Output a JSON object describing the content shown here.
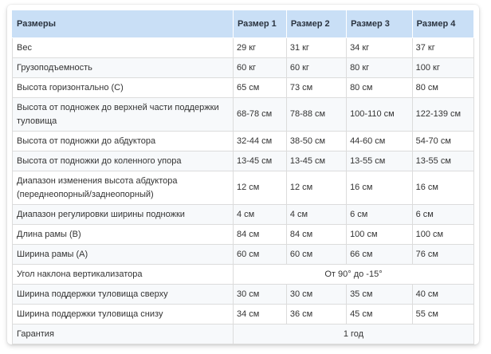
{
  "table": {
    "headers": [
      "Размеры",
      "Размер 1",
      "Размер 2",
      "Размер 3",
      "Размер 4"
    ],
    "rows": [
      {
        "label": "Вес",
        "values": [
          "29 кг",
          "31 кг",
          "34 кг",
          " 37 кг"
        ]
      },
      {
        "label": "Грузоподъемность",
        "values": [
          "60 кг",
          "60 кг",
          "80 кг",
          "100 кг"
        ]
      },
      {
        "label": "Высота горизонтально (С)",
        "values": [
          "65 см",
          "73 см",
          "80 см",
          "80 см"
        ]
      },
      {
        "label": "Высота от подножек до верхней части поддержки туловища",
        "values": [
          "68-78 см",
          "78-88 см",
          "100-110 см",
          "122-139 см"
        ]
      },
      {
        "label": "Высота от подножки до абдуктора",
        "values": [
          "32-44 см",
          "38-50 см",
          "44-60 см",
          "54-70 см"
        ]
      },
      {
        "label": "Высота от подножки до коленного упора",
        "values": [
          "13-45 см",
          "13-45 см",
          "13-55 см",
          "13-55 см"
        ]
      },
      {
        "label": "Диапазон изменения высота абдуктора (переднеопорный/заднеопорный)",
        "values": [
          "12 см",
          "12 см",
          "16 см",
          "16 см"
        ]
      },
      {
        "label": "Диапазон регулировки ширины подножки",
        "values": [
          "4 см",
          "4 см",
          "6 см",
          " 6 см"
        ]
      },
      {
        "label": "Длина рамы (В)",
        "values": [
          "84 см",
          "84 см",
          "100 см",
          "100 см"
        ]
      },
      {
        "label": "Ширина рамы (А)",
        "values": [
          "60 см",
          "60 см",
          "66 см",
          "76 см"
        ]
      },
      {
        "label": "Угол наклона вертикализатора",
        "merged": "От 90° до -15°"
      },
      {
        "label": "Ширина поддержки туловища сверху",
        "values": [
          "30 см",
          "30 см",
          "35 см",
          "40 см"
        ]
      },
      {
        "label": "Ширина поддержки туловища снизу",
        "values": [
          "34 см",
          "36 см",
          "45 см",
          "55 см"
        ]
      },
      {
        "label": "Гарантия",
        "merged": "1 год"
      }
    ]
  },
  "colors": {
    "header_bg": "#c9dff6",
    "border": "#dcdcdc",
    "text": "#333333"
  }
}
